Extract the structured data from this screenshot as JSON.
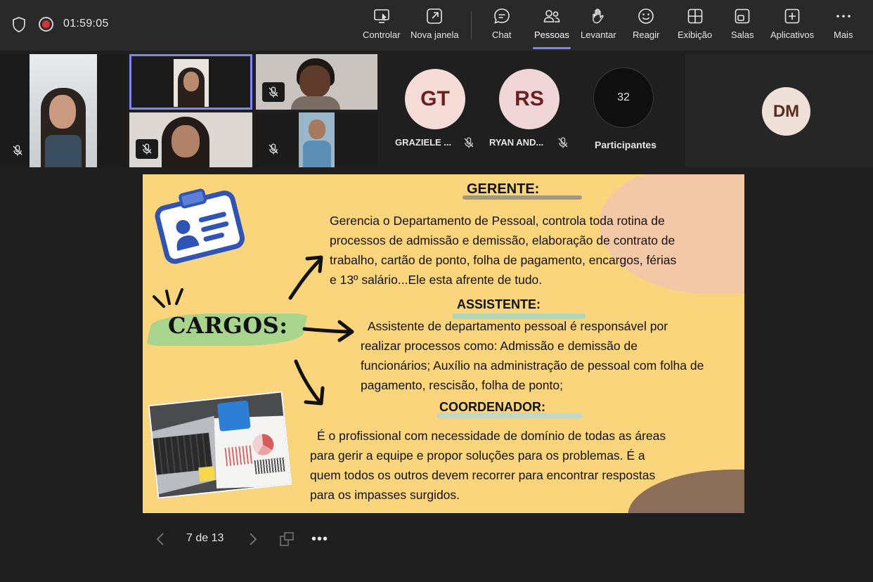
{
  "meeting": {
    "timer": "01:59:05"
  },
  "toolbar": {
    "controlar": "Controlar",
    "nova_janela": "Nova janela",
    "chat": "Chat",
    "pessoas": "Pessoas",
    "levantar": "Levantar",
    "reagir": "Reagir",
    "exibicao": "Exibição",
    "salas": "Salas",
    "aplicativos": "Aplicativos",
    "mais": "Mais"
  },
  "participants": {
    "gt": {
      "initials": "GT",
      "name": "GRAZIELE ...",
      "color": "#f5dcd7",
      "text_color": "#6b1f1f"
    },
    "rs": {
      "initials": "RS",
      "name": "RYAN AND...",
      "color": "#f0d6d6",
      "text_color": "#6b1f1f"
    },
    "more": {
      "count": "32",
      "label": "Participantes"
    },
    "dm": {
      "initials": "DM",
      "color": "#efe0d8",
      "text_color": "#5a2c20"
    }
  },
  "slide": {
    "cargos": "CARGOS:",
    "gerente_title": "GERENTE:",
    "gerente_lines": [
      "Gerencia o Departamento de Pessoal, controla toda rotina de",
      "processos de admissão e demissão, elaboração de contrato de",
      "trabalho, cartão de ponto, folha de pagamento, encargos, férias",
      "e 13º salário...Ele esta afrente de tudo."
    ],
    "assistente_title": "ASSISTENTE:",
    "assistente_lines": [
      "Assistente de departamento pessoal é responsável por",
      "realizar processos como: Admissão e demissão de",
      "funcionários; Auxílio na administração de pessoal com folha de",
      "pagamento, rescisão, folha de ponto;"
    ],
    "coordenador_title": "COORDENADOR:",
    "coordenador_lines": [
      "É o profissional com necessidade de domínio de todas as áreas",
      "para gerir a equipe e propor soluções para os problemas. É a",
      "quem todos os outros devem recorrer para encontrar respostas",
      "para os impasses surgidos."
    ]
  },
  "nav": {
    "page_indicator": "7 de 13",
    "more": "•••"
  }
}
